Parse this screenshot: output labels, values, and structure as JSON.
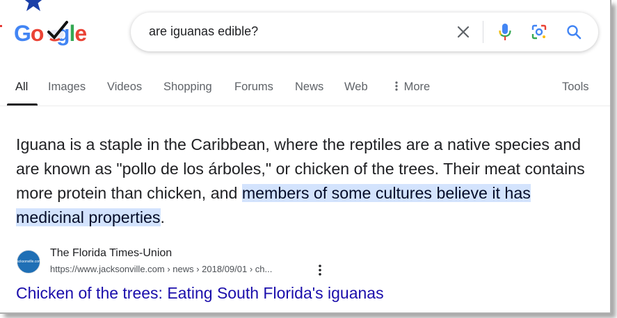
{
  "header": {
    "logo_text": "Google",
    "search": {
      "query": "are iguanas edible?"
    }
  },
  "tabs": [
    {
      "label": "All",
      "active": true
    },
    {
      "label": "Images"
    },
    {
      "label": "Videos"
    },
    {
      "label": "Shopping"
    },
    {
      "label": "Forums"
    },
    {
      "label": "News"
    },
    {
      "label": "Web"
    },
    {
      "label": "More"
    }
  ],
  "tools_label": "Tools",
  "snippet": {
    "plain": "Iguana is a staple in the Caribbean, where the reptiles are a native species and are known as \"pollo de los árboles,\" or chicken of the trees. Their meat contains more protein than chicken, and ",
    "highlighted": "members of some cultures believe it has medicinal properties",
    "end": "."
  },
  "result": {
    "source_name": "The Florida Times-Union",
    "url": "https://www.jacksonville.com › news › 2018/09/01 › ch...",
    "title": "Chicken of the trees: Eating South Florida's iguanas",
    "favicon_text": "jacksonville.com"
  },
  "colors": {
    "link": "#1a0dab",
    "highlight": "#d3e3fd",
    "google_blue": "#4285f4",
    "google_red": "#ea4335",
    "google_yellow": "#fbbc05",
    "google_green": "#34a853"
  },
  "icons": [
    "star-icon",
    "checkmark-icon",
    "clear-icon",
    "mic-icon",
    "lens-icon",
    "search-icon",
    "more-vert-icon"
  ]
}
